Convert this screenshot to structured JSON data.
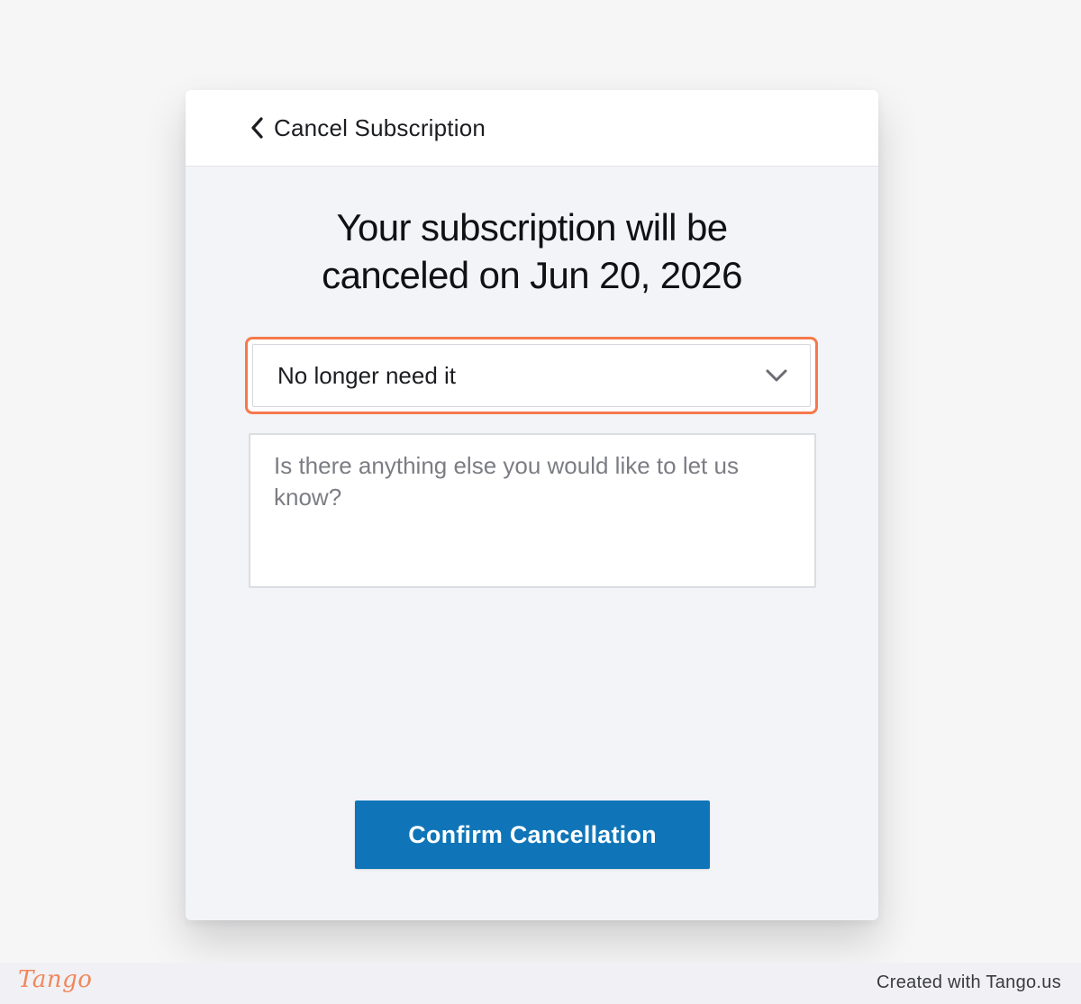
{
  "header": {
    "back_icon": "chevron-left-icon",
    "title": "Cancel Subscription"
  },
  "main": {
    "headline_line1": "Your subscription will be",
    "headline_line2": "canceled on Jun 20, 2026",
    "reason_select": {
      "selected_value": "No longer need it",
      "icon": "chevron-down-icon",
      "highlight_color": "#f5794c"
    },
    "feedback": {
      "value": "",
      "placeholder": "Is there anything else you would like to let us know?"
    },
    "confirm_label": "Confirm Cancellation",
    "confirm_color": "#0f75b8"
  },
  "footer": {
    "logo_text": "Tango",
    "credit": "Created with Tango.us",
    "logo_color": "#f0875b"
  }
}
